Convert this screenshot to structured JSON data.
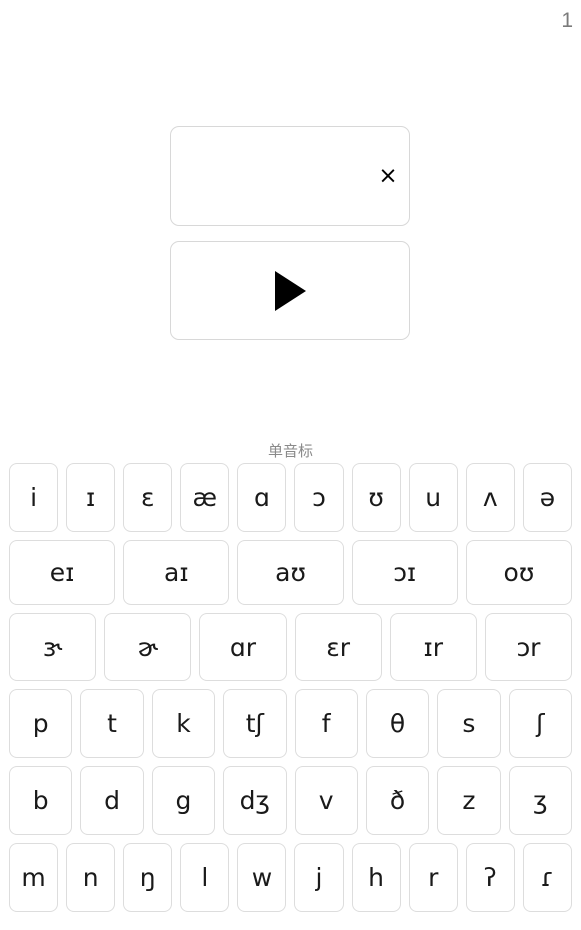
{
  "header": {
    "counter": "1"
  },
  "input_card": {
    "value": "",
    "placeholder": "",
    "clear_icon": "close-x-icon",
    "clear_label": "×"
  },
  "play_card": {
    "icon": "play-triangle-icon",
    "label": ""
  },
  "section": {
    "label": "单音标"
  },
  "colors": {
    "page_background": "#ffffff",
    "key_border": "#dddddd",
    "card_border": "#d8d8d8",
    "text": "#1a1a1a",
    "muted_text": "#8a8a8a",
    "counter_text": "#7b7b7b",
    "icon": "#000000"
  },
  "keyboard": {
    "rows": [
      {
        "name": "monophthongs",
        "keys": [
          "i",
          "ɪ",
          "ɛ",
          "æ",
          "ɑ",
          "ɔ",
          "ʊ",
          "u",
          "ʌ",
          "ə"
        ]
      },
      {
        "name": "diphthongs",
        "keys": [
          "eɪ",
          "aɪ",
          "aʊ",
          "ɔɪ",
          "oʊ"
        ]
      },
      {
        "name": "r-colored",
        "keys": [
          "ɝ",
          "ɚ",
          "ɑr",
          "ɛr",
          "ɪr",
          "ɔr"
        ]
      },
      {
        "name": "voiceless-consonants",
        "keys": [
          "p",
          "t",
          "k",
          "tʃ",
          "f",
          "θ",
          "s",
          "ʃ"
        ]
      },
      {
        "name": "voiced-consonants",
        "keys": [
          "b",
          "d",
          "g",
          "dʒ",
          "v",
          "ð",
          "z",
          "ʒ"
        ]
      },
      {
        "name": "sonorants",
        "keys": [
          "m",
          "n",
          "ŋ",
          "l",
          "w",
          "j",
          "h",
          "r",
          "ʔ",
          "ɾ"
        ]
      }
    ]
  }
}
